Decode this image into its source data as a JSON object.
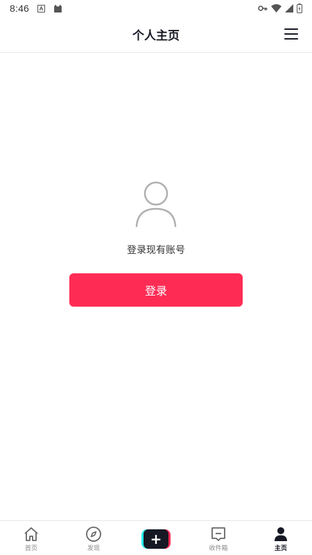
{
  "status_bar": {
    "time": "8:46",
    "left_icons": [
      "a-box-icon",
      "cat-icon"
    ],
    "right_icons": [
      "key-icon",
      "wifi-icon",
      "signal-icon",
      "battery-icon"
    ]
  },
  "header": {
    "title": "个人主页",
    "menu_icon": "hamburger-menu-icon"
  },
  "main": {
    "avatar_icon": "user-outline-icon",
    "prompt": "登录现有账号",
    "login_label": "登录"
  },
  "tab_bar": {
    "items": [
      {
        "label": "首页",
        "icon": "home-icon",
        "active": false
      },
      {
        "label": "发现",
        "icon": "compass-icon",
        "active": false
      },
      {
        "label": "",
        "icon": "create-plus-icon",
        "active": false
      },
      {
        "label": "收件箱",
        "icon": "inbox-icon",
        "active": false
      },
      {
        "label": "主页",
        "icon": "profile-icon",
        "active": true
      }
    ]
  },
  "colors": {
    "accent": "#fe2c55",
    "accent_cyan": "#25f4ee",
    "text_primary": "#161823",
    "text_secondary": "#888888"
  }
}
